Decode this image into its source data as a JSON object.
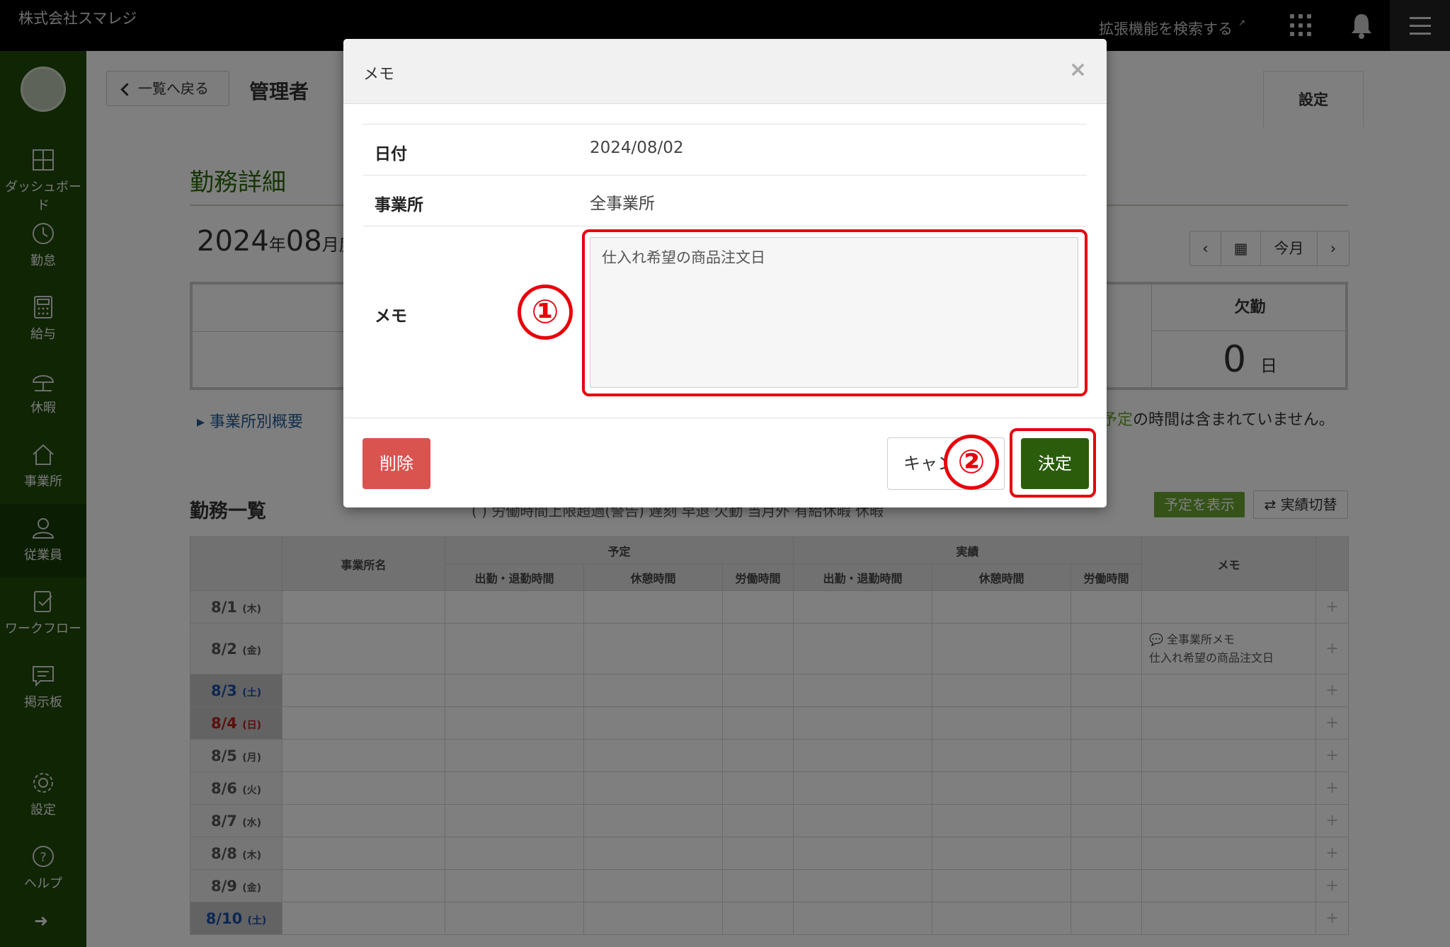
{
  "topbar": {
    "company": "株式会社スマレジ",
    "ext_search": "拡張機能を検索する"
  },
  "sidebar": {
    "items": [
      {
        "label": "ダッシュボード",
        "icon": "dashboard-icon"
      },
      {
        "label": "勤怠",
        "icon": "clock-icon"
      },
      {
        "label": "給与",
        "icon": "calculator-icon"
      },
      {
        "label": "休暇",
        "icon": "umbrella-icon"
      },
      {
        "label": "事業所",
        "icon": "home-icon"
      },
      {
        "label": "従業員",
        "icon": "user-icon"
      },
      {
        "label": "ワークフロー",
        "icon": "workflow-icon"
      },
      {
        "label": "掲示板",
        "icon": "message-icon"
      },
      {
        "label": "設定",
        "icon": "gear-icon"
      },
      {
        "label": "ヘルプ",
        "icon": "help-icon"
      }
    ]
  },
  "header": {
    "back_label": "一覧へ戻る",
    "title": "管理者",
    "settings_tab": "設定"
  },
  "detail": {
    "section_title": "勤務詳細",
    "year": "2024",
    "year_unit": "年",
    "month": "08",
    "month_unit": "月度",
    "nav_today": "今月",
    "absence_label": "欠勤",
    "absence_value": "0",
    "absence_unit": "日",
    "office_summary_link": "事業所別概要",
    "note_highlight": "予定",
    "note_rest": "の時間は含まれていません。"
  },
  "list": {
    "title": "勤務一覧",
    "legend_text": "(   ) 労働時間上限超過(警告)       遅刻   早退   欠勤   当月外   有給休暇   休暇",
    "show_plan_button": "予定を表示",
    "switch_button": "実績切替",
    "headers": {
      "office": "事業所名",
      "plan": "予定",
      "actual": "実績",
      "in_out": "出勤・退勤時間",
      "rest": "休憩時間",
      "work": "労働時間",
      "memo": "メモ"
    },
    "rows": [
      {
        "date": "8/1",
        "dow": "(木)",
        "type": "weekday"
      },
      {
        "date": "8/2",
        "dow": "(金)",
        "type": "memo",
        "memo_title": "全事業所メモ",
        "memo_text": "仕入れ希望の商品注文日"
      },
      {
        "date": "8/3",
        "dow": "(土)",
        "type": "sat"
      },
      {
        "date": "8/4",
        "dow": "(日)",
        "type": "sun"
      },
      {
        "date": "8/5",
        "dow": "(月)",
        "type": "weekday"
      },
      {
        "date": "8/6",
        "dow": "(火)",
        "type": "weekday"
      },
      {
        "date": "8/7",
        "dow": "(水)",
        "type": "weekday"
      },
      {
        "date": "8/8",
        "dow": "(木)",
        "type": "weekday"
      },
      {
        "date": "8/9",
        "dow": "(金)",
        "type": "weekday"
      },
      {
        "date": "8/10",
        "dow": "(土)",
        "type": "sat"
      }
    ]
  },
  "modal": {
    "title": "メモ",
    "date_label": "日付",
    "date_value": "2024/08/02",
    "office_label": "事業所",
    "office_value": "全事業所",
    "memo_label": "メモ",
    "memo_value": "仕入れ希望の商品注文日",
    "delete_button": "削除",
    "cancel_button": "キャンセル",
    "ok_button": "決定"
  },
  "annotations": {
    "step1": "①",
    "step2": "②",
    "color": "#e8000b"
  },
  "colors": {
    "sidebar": "#1e4a06",
    "accent_green": "#2b5c0c",
    "delete_red": "#d9534f",
    "title_green": "#2d6b0c"
  }
}
